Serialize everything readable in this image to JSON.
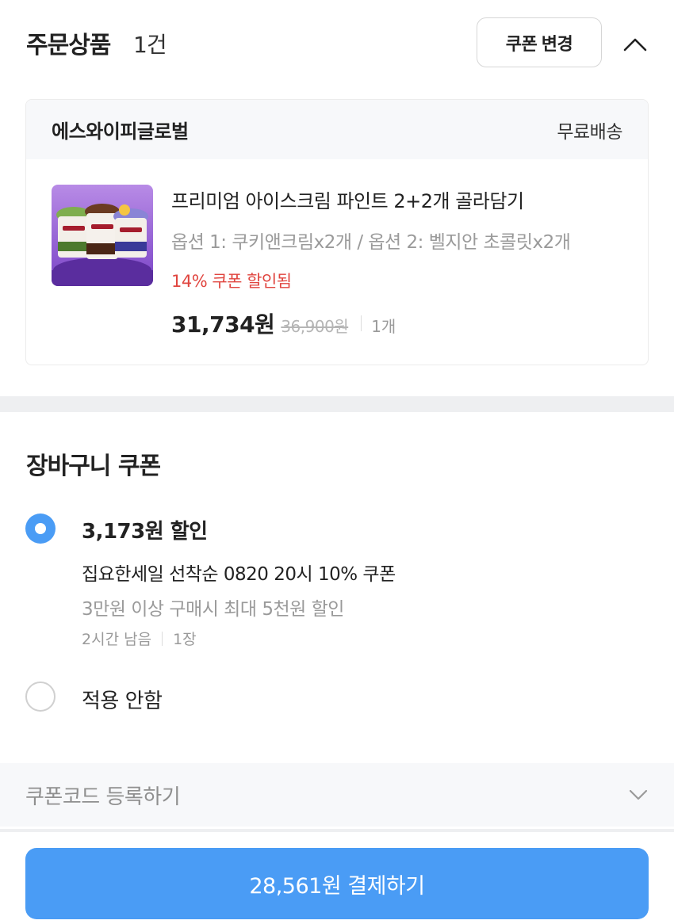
{
  "order": {
    "title": "주문상품",
    "count": "1건",
    "coupon_change_label": "쿠폰 변경",
    "collapse_icon": "chevron-up-icon"
  },
  "seller": {
    "name": "에스와이피글로벌",
    "shipping": "무료배송"
  },
  "product": {
    "image_icon": "ice-cream-product-image",
    "name": "프리미엄 아이스크림 파인트 2+2개 골라담기",
    "option": "옵션 1: 쿠키앤크림x2개 / 옵션 2: 벨지안 초콜릿x2개",
    "discount_note": "14% 쿠폰 할인됨",
    "sale_price": "31,734원",
    "original_price": "36,900원",
    "quantity": "1개"
  },
  "cart_coupon": {
    "title": "장바구니 쿠폰",
    "options": [
      {
        "selected": true,
        "amount": "3,173원 할인",
        "name": "집요한세일 선착순 0820 20시 10% 쿠폰",
        "condition": "3만원 이상 구매시 최대 5천원 할인",
        "time_left": "2시간 남음",
        "count": "1장"
      },
      {
        "selected": false,
        "label": "적용 안함"
      }
    ]
  },
  "coupon_code": {
    "label": "쿠폰코드 등록하기",
    "icon": "chevron-down-icon"
  },
  "payment": {
    "button_label": "28,561원 결제하기"
  },
  "colors": {
    "accent": "#4a9cf5",
    "discount_red": "#e0453f",
    "muted_text": "#9a9a9a",
    "panel_bg": "#f7f8fa"
  }
}
